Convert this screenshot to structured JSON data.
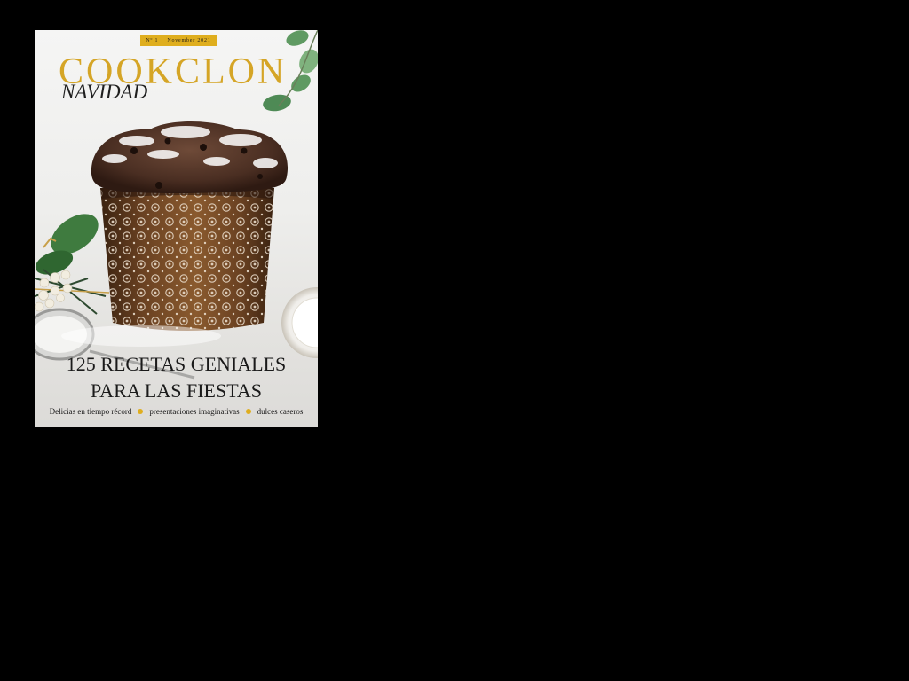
{
  "cover": {
    "issue_number": "Nº 1",
    "issue_date": "November 2021",
    "masthead": "COOKCLON",
    "edition": "NAVIDAD",
    "headline_line1": "125 RECETAS GENIALES",
    "headline_line2": "PARA LAS FIESTAS",
    "taglines": [
      "Delicias en tiempo récord",
      "presentaciones imaginativas",
      "dulces caseros"
    ]
  },
  "colors": {
    "background": "#000000",
    "accent_gold": "#dfae1e",
    "masthead_gold": "#d5a526",
    "text_dark": "#1a1a1a"
  },
  "icons": [
    "panettone-image",
    "eucalyptus-leaves",
    "sifter",
    "berries",
    "white-plate",
    "bullet-dot"
  ]
}
